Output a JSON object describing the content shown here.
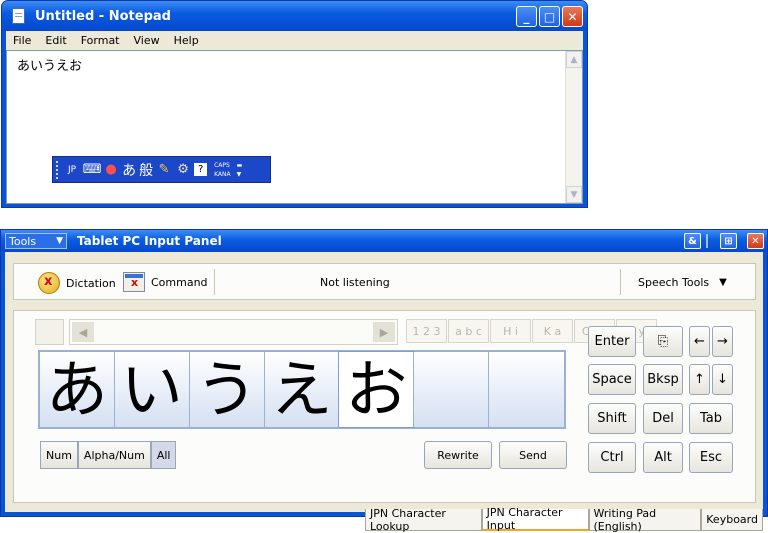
{
  "notepad": {
    "title": "Untitled - Notepad",
    "menu": [
      "File",
      "Edit",
      "Format",
      "View",
      "Help"
    ],
    "text": "あいうえお",
    "caption": {
      "minimize": "_",
      "maximize": "□",
      "close": "✕"
    }
  },
  "langbar": {
    "language": "JP",
    "kana_glyph": "あ",
    "mode_glyph": "般",
    "caps_label": "CAPS",
    "kana_label": "KANA",
    "icons": [
      "keyboard-icon",
      "ime-icon",
      "pad-icon",
      "settings-icon",
      "help-icon"
    ]
  },
  "tip": {
    "tools_label": "Tools",
    "title": "Tablet PC Input Panel",
    "speech": {
      "dictation": "Dictation",
      "command": "Command",
      "status": "Not listening",
      "tools": "Speech Tools"
    },
    "filters": [
      "1 2 3",
      "a b c",
      "H i",
      "K a",
      "C J K",
      "S y"
    ],
    "chars": [
      "あ",
      "い",
      "う",
      "え",
      "お",
      "",
      ""
    ],
    "modes": [
      "Num",
      "Alpha/Num",
      "All"
    ],
    "rewrite": "Rewrite",
    "send": "Send",
    "keys": {
      "enter": "Enter",
      "space": "Space",
      "bksp": "Bksp",
      "shift": "Shift",
      "del": "Del",
      "tab": "Tab",
      "ctrl": "Ctrl",
      "alt": "Alt",
      "esc": "Esc",
      "left": "←",
      "right": "→",
      "up": "↑",
      "down": "↓"
    },
    "tabs": [
      "JPN Character Lookup",
      "JPN Character Input",
      "Writing Pad (English)",
      "Keyboard"
    ],
    "active_tab": "JPN Character Input"
  }
}
